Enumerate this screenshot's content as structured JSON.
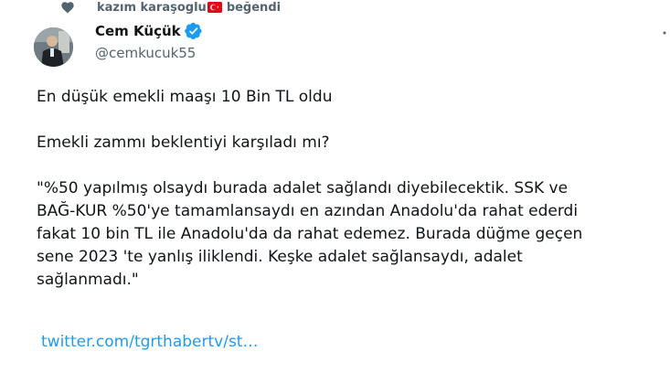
{
  "social_context": {
    "user": "kazım karaşoglu",
    "action": "beğendi",
    "icon": "heart-icon",
    "flag_icon": "turkey-flag-icon"
  },
  "author": {
    "display_name": "Cem Küçük",
    "handle": "@cemkucuk55",
    "verified": true,
    "verified_color": "#1d9bf0"
  },
  "tweet": {
    "text": "En düşük emekli maaşı 10 Bin TL oldu\n\nEmekli zammı beklentiyi karşıladı mı?\n\n\"%50 yapılmış olsaydı burada adalet sağlandı diyebilecektik. SSK ve\nBAĞ-KUR %50'ye tamamlansaydı en azından Anadolu'da rahat ederdi\nfakat 10 bin TL ile Anadolu'da da rahat edemez. Burada düğme geçen\nsene 2023 'te yanlış iliklendi. Keşke adalet sağlansaydı, adalet\nsağlanmadı.\"",
    "link_text": "twitter.com/tgrthabertv/st…",
    "link_color": "#1d9bf0"
  }
}
